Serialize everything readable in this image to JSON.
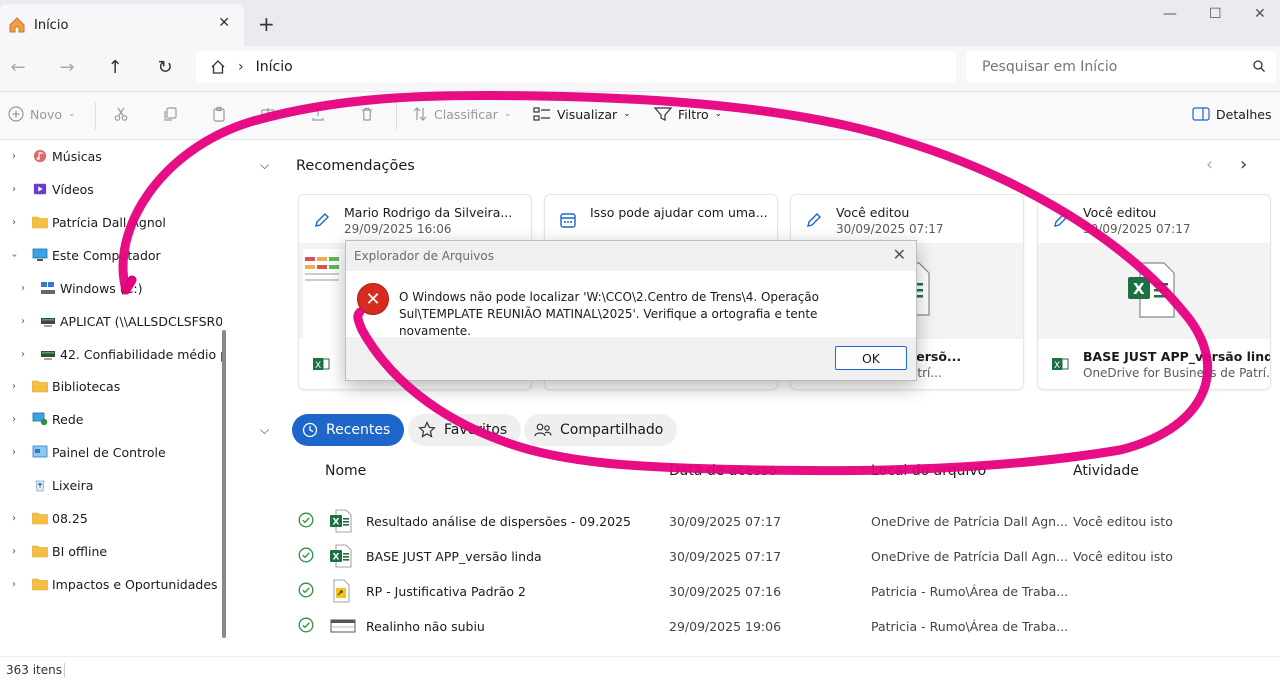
{
  "window": {
    "tab_label": "Início",
    "tab_close": "✕",
    "new_tab": "+",
    "minimize": "—",
    "maximize": "☐",
    "close": "✕"
  },
  "address": {
    "crumb": "Início",
    "separator": "›",
    "search_placeholder": "Pesquisar em Início"
  },
  "toolbar": {
    "new_label": "Novo",
    "sort_label": "Classificar",
    "view_label": "Visualizar",
    "filter_label": "Filtro",
    "more_label": "•••",
    "details_label": "Detalhes"
  },
  "sidebar": {
    "items": [
      {
        "label": "Músicas",
        "icon": "music-icon"
      },
      {
        "label": "Vídeos",
        "icon": "video-icon"
      },
      {
        "label": "Patrícia Dall Agnol",
        "icon": "folder-icon"
      },
      {
        "label": "Este Computador",
        "icon": "computer-icon"
      },
      {
        "label": "Windows (C:)",
        "icon": "drive-icon"
      },
      {
        "label": "APLICAT (\\\\ALLSDCLSFSR01)",
        "icon": "network-drive-icon"
      },
      {
        "label": "42. Confiabilidade médio pra",
        "icon": "network-drive-icon"
      },
      {
        "label": "Bibliotecas",
        "icon": "folder-icon"
      },
      {
        "label": "Rede",
        "icon": "network-icon"
      },
      {
        "label": "Painel de Controle",
        "icon": "control-panel-icon"
      },
      {
        "label": "Lixeira",
        "icon": "recycle-bin-icon"
      },
      {
        "label": "08.25",
        "icon": "folder-icon"
      },
      {
        "label": "BI offline",
        "icon": "folder-icon"
      },
      {
        "label": "Impactos e Oportunidades Po",
        "icon": "folder-icon"
      }
    ]
  },
  "recommendations": {
    "title": "Recomendações",
    "cards": [
      {
        "title": "Mario Rodrigo da Silveira...",
        "date": "29/09/2025 16:06",
        "file_name": "",
        "location": ""
      },
      {
        "title": "Isso pode ajudar com uma...",
        "date": "",
        "file_name": "",
        "location": ""
      },
      {
        "title": "Você editou",
        "date": "30/09/2025 07:17",
        "file_name": "lise de dispersõ...",
        "location": "usiness de Patrí..."
      },
      {
        "title": "Você editou",
        "date": "30/09/2025 07:17",
        "file_name": "BASE JUST APP_versão linda",
        "location": "OneDrive for Business de Patrí..."
      }
    ]
  },
  "filters": {
    "recent": "Recentes",
    "favorites": "Favoritos",
    "shared": "Compartilhado"
  },
  "columns": {
    "name": "Nome",
    "date": "Data de acesso",
    "location": "Local do arquivo",
    "activity": "Atividade"
  },
  "files": [
    {
      "name": "Resultado análise de dispersões - 09.2025",
      "date": "30/09/2025 07:17",
      "location": "OneDrive de Patrícia Dall Agn...",
      "activity": "Você editou isto",
      "type": "excel"
    },
    {
      "name": "BASE JUST APP_versão linda",
      "date": "30/09/2025 07:17",
      "location": "OneDrive de Patrícia Dall Agn...",
      "activity": "Você editou isto",
      "type": "excel"
    },
    {
      "name": "RP - Justificativa Padrão 2",
      "date": "30/09/2025 07:16",
      "location": "Patricia - Rumo\\Área de Traba...",
      "activity": "",
      "type": "access"
    },
    {
      "name": "Realinho não subiu",
      "date": "29/09/2025 19:06",
      "location": "Patricia - Rumo\\Área de Traba...",
      "activity": "",
      "type": "table"
    }
  ],
  "status": {
    "count": "363 itens"
  },
  "dialog": {
    "title": "Explorador de Arquivos",
    "message": "O Windows não pode localizar 'W:\\CCO\\2.Centro de Trens\\4. Operação Sul\\TEMPLATE REUNIÃO MATINAL\\2025'. Verifique a ortografia e tente novamente.",
    "ok": "OK",
    "close": "✕",
    "error_glyph": "✕"
  },
  "colors": {
    "accent": "#1e66c9",
    "annotation": "#e5007e",
    "excel": "#1d7044",
    "error": "#d62b1f"
  }
}
